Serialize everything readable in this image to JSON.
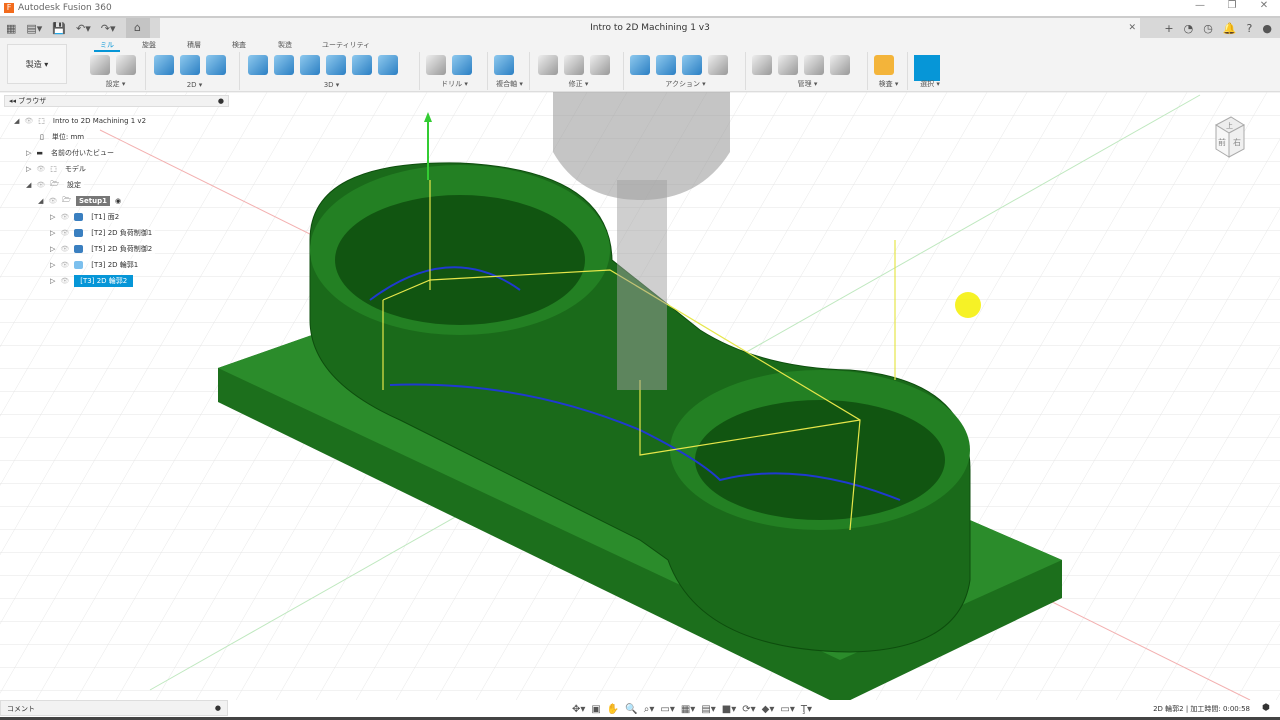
{
  "app": {
    "title": "Autodesk Fusion 360",
    "logo": "F"
  },
  "document": {
    "title": "Intro to 2D Machining 1 v3"
  },
  "ribbon": {
    "workspace": "製造 ▾",
    "tabs": [
      "ミル",
      "旋盤",
      "積層",
      "検査",
      "製造",
      "ユーティリティ"
    ],
    "active_tab": "ミル",
    "groups": [
      "設定 ▾",
      "2D ▾",
      "3D ▾",
      "ドリル ▾",
      "複合軸 ▾",
      "修正 ▾",
      "アクション ▾",
      "管理 ▾",
      "検査 ▾",
      "選択 ▾"
    ]
  },
  "browser": {
    "title": "ブラウザ",
    "root": "Intro to 2D Machining 1 v2",
    "units": "単位: mm",
    "named_views": "名前の付いたビュー",
    "model": "モデル",
    "setups": "設定",
    "setup": "Setup1",
    "operations": [
      "[T1] 面2",
      "[T2] 2D 負荷制御1",
      "[T5] 2D 負荷制御2",
      "[T3] 2D 輪郭1",
      "[T3] 2D 輪郭2"
    ],
    "selected_operation": "[T3] 2D 輪郭2"
  },
  "comment": "コメント",
  "status": "2D 輪郭2 | 加工時間: 0:00:58",
  "viewcube": {
    "front": "前",
    "right": "右",
    "top": "上"
  },
  "colors": {
    "accent": "#0696d7",
    "part": "#1f7a1f",
    "stock": "#2a8a2a"
  }
}
